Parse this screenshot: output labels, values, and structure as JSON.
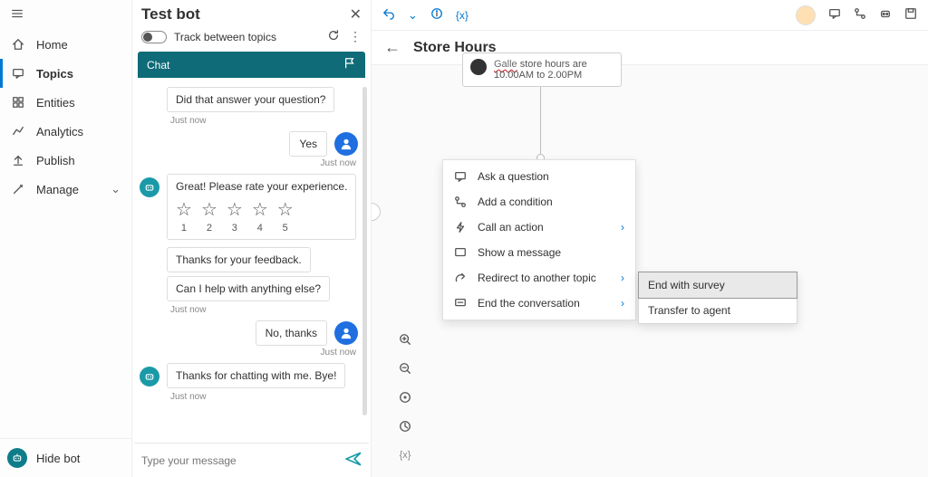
{
  "nav": {
    "items": [
      {
        "label": "Home"
      },
      {
        "label": "Topics"
      },
      {
        "label": "Entities"
      },
      {
        "label": "Analytics"
      },
      {
        "label": "Publish"
      },
      {
        "label": "Manage"
      }
    ],
    "footer_label": "Hide bot"
  },
  "panel": {
    "title": "Test bot",
    "track_label": "Track between topics",
    "chat_label": "Chat"
  },
  "chat": {
    "m0": "Did that answer your question?",
    "ts0": "Just now",
    "m1": "Yes",
    "ts1": "Just now",
    "m2": "Great! Please rate your experience.",
    "rating": {
      "r1": "1",
      "r2": "2",
      "r3": "3",
      "r4": "4",
      "r5": "5"
    },
    "m3": "Thanks for your feedback.",
    "m4": "Can I help with anything else?",
    "ts4": "Just now",
    "m5": "No, thanks",
    "ts5": "Just now",
    "m6": "Thanks for chatting with me. Bye!",
    "ts6": "Just now",
    "placeholder": "Type your message"
  },
  "canvas": {
    "vars_label": "{x}",
    "title": "Store Hours",
    "node_prefix": "Galle",
    "node_rest": " store hours are 10.00AM to 2.00PM"
  },
  "menu": {
    "items": {
      "ask": "Ask a question",
      "cond": "Add a condition",
      "call": "Call an action",
      "msg": "Show a message",
      "redir": "Redirect to another topic",
      "end": "End the conversation"
    }
  },
  "submenu": {
    "survey": "End with survey",
    "transfer": "Transfer to agent"
  },
  "tools": {
    "vars": "{x}"
  }
}
